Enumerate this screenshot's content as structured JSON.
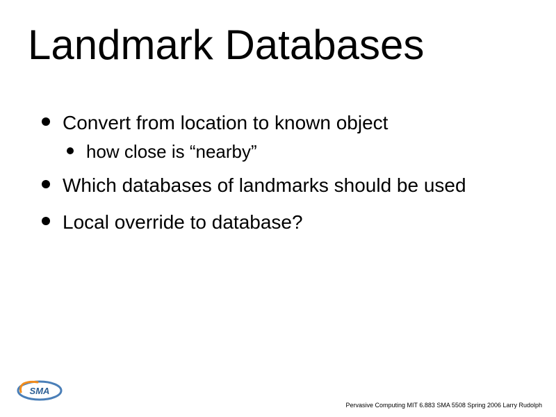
{
  "title": "Landmark Databases",
  "bullets": {
    "b1": "Convert from location to known object",
    "b1a": "how close is “nearby”",
    "b2": "Which databases of landmarks should be used",
    "b3": "Local override to database?"
  },
  "footer": "Pervasive Computing MIT 6.883 SMA 5508 Spring 2006 Larry Rudolph",
  "logo_text": "SMA"
}
